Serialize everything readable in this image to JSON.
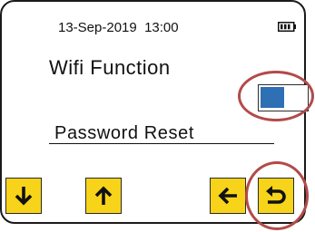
{
  "status": {
    "datetime": "13-Sep-2019  13:00",
    "battery_icon": "battery-full-icon"
  },
  "settings": {
    "wifi_label": "Wifi Function",
    "wifi_enabled": false,
    "password_reset_label": "Password Reset"
  },
  "buttons": {
    "down_icon": "arrow-down-icon",
    "up_icon": "arrow-up-icon",
    "left_icon": "arrow-left-icon",
    "back_icon": "return-icon"
  },
  "colors": {
    "button_fill": "#f7d31a",
    "toggle_knob": "#2f6fb3",
    "highlight_ring": "#b24a4a"
  }
}
